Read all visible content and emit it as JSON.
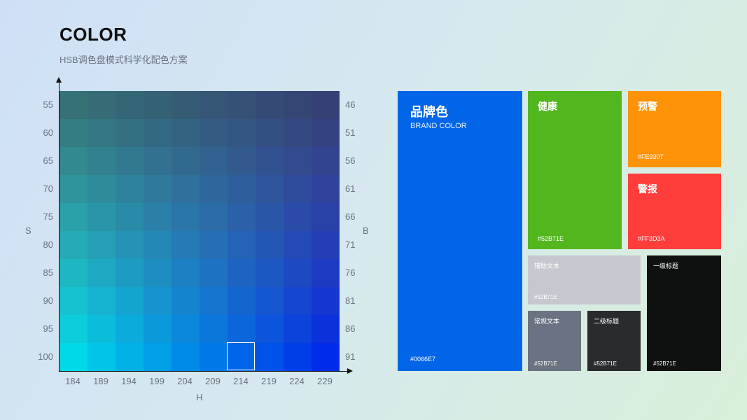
{
  "header": {
    "title": "COLOR",
    "subtitle": "HSB调色盘模式科学化配色方案"
  },
  "palette": {
    "axis_h_label": "H",
    "axis_s_label": "S",
    "axis_b_label": "B",
    "h_values": [
      "184",
      "189",
      "194",
      "199",
      "204",
      "209",
      "214",
      "219",
      "224",
      "229"
    ],
    "s_values": [
      "55",
      "60",
      "65",
      "70",
      "75",
      "80",
      "85",
      "90",
      "95",
      "100"
    ],
    "b_values": [
      "46",
      "51",
      "56",
      "61",
      "66",
      "71",
      "76",
      "81",
      "86",
      "91"
    ],
    "selected": {
      "h": "214",
      "s": "100"
    }
  },
  "swatches": {
    "brand": {
      "name": "品牌色",
      "subtitle": "BRAND COLOR",
      "code": "#0066E7",
      "color": "#0066E7"
    },
    "health": {
      "name": "健康",
      "code": "#52B71E",
      "color": "#52B71E"
    },
    "warning": {
      "name": "预警",
      "code": "#FE9307",
      "color": "#FE9307"
    },
    "alarm": {
      "name": "警报",
      "code": "#FF3D3A",
      "color": "#FF3D3A"
    },
    "aux_text": {
      "name": "辅助文本",
      "code": "#52B71E",
      "color": "#C5C9CF"
    },
    "normal_text": {
      "name": "常规文本",
      "code": "#52B71E",
      "color": "#6B7383"
    },
    "h2_title": {
      "name": "二级标题",
      "code": "#52B71E",
      "color": "#2A2B2E"
    },
    "h1_title": {
      "name": "一级标题",
      "code": "#52B71E",
      "color": "#0F1010"
    }
  }
}
